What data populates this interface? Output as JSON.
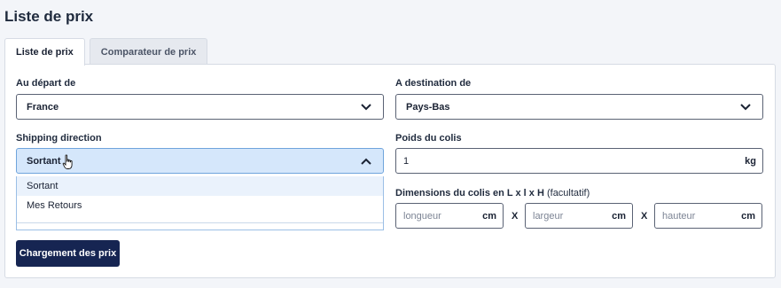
{
  "page": {
    "title": "Liste de prix"
  },
  "tabs": [
    {
      "label": "Liste de prix",
      "active": true
    },
    {
      "label": "Comparateur de prix",
      "active": false
    }
  ],
  "form": {
    "departure": {
      "label": "Au départ de",
      "value": "France"
    },
    "destination": {
      "label": "A destination de",
      "value": "Pays-Bas"
    },
    "shipping_direction": {
      "label": "Shipping direction",
      "value": "Sortant",
      "options": [
        "Sortant",
        "Mes Retours"
      ]
    },
    "weight": {
      "label": "Poids du colis",
      "value": "1",
      "unit": "kg"
    },
    "dimensions": {
      "label": "Dimensions du colis en L x l x H",
      "label_suffix": "(facultatif)",
      "separator": "X",
      "length": {
        "placeholder": "longueur",
        "unit": "cm"
      },
      "width": {
        "placeholder": "largeur",
        "unit": "cm"
      },
      "height": {
        "placeholder": "hauteur",
        "unit": "cm"
      }
    },
    "submit_label": "Chargement des prix"
  },
  "colors": {
    "primary": "#162552",
    "open_select": "#d5e7fb",
    "highlight": "#eaf2fc"
  }
}
